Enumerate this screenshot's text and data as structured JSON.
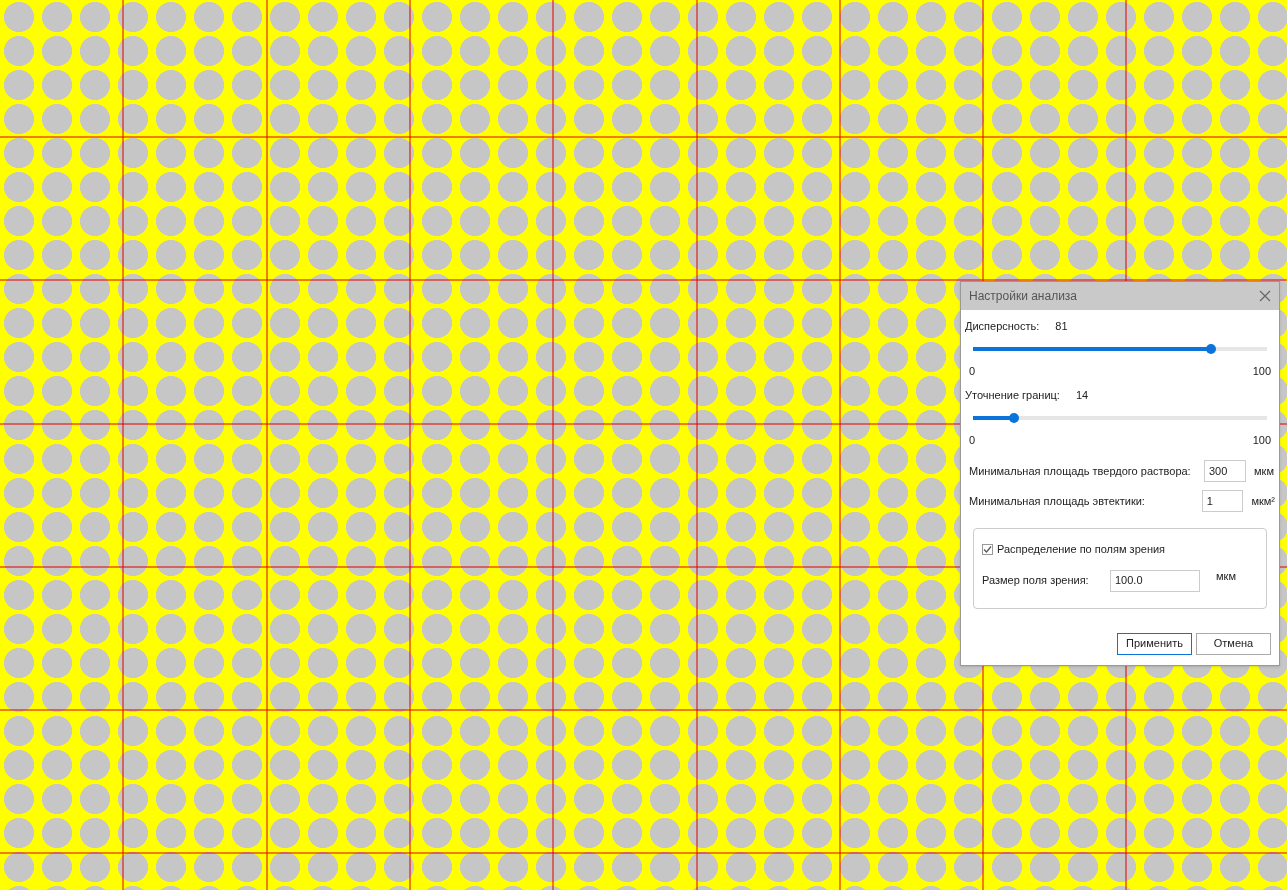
{
  "dialog": {
    "title": "Настройки анализа",
    "sliders": [
      {
        "label": "Дисперсность:",
        "reading": "81",
        "level": 0.81,
        "min": "0",
        "max": "100"
      },
      {
        "label": "Уточнение границ:",
        "reading": "14",
        "level": 0.14,
        "min": "0",
        "max": "100"
      }
    ],
    "fields": [
      {
        "label": "Минимальная площадь твердого раствора:",
        "value": "300",
        "unit": "мкм"
      },
      {
        "label": "Минимальная площадь эвтектики:",
        "value": "1",
        "unit": "мкм²"
      }
    ],
    "group": {
      "checkbox": {
        "label": "Распределение по полям зрения",
        "checked": true
      },
      "field": {
        "label": "Размер поля зрения:",
        "value": "100.0",
        "unit": "мкм"
      }
    },
    "buttons": [
      {
        "label": "Применить",
        "kind": "primary"
      },
      {
        "label": "Отмена",
        "kind": "secondary"
      }
    ]
  }
}
